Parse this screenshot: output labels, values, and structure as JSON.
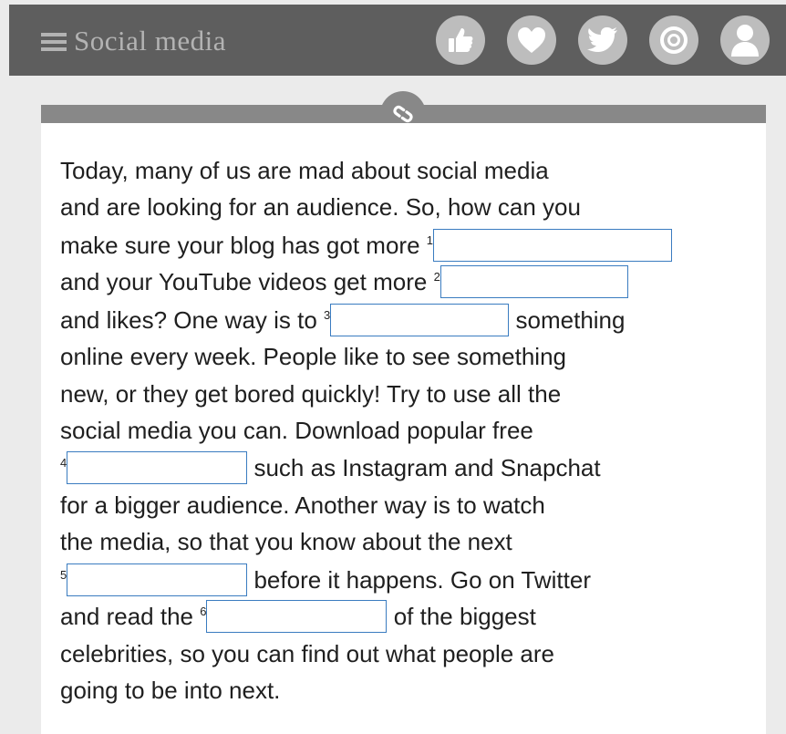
{
  "header": {
    "title": "Social media",
    "icons": [
      "thumbs-up-icon",
      "heart-icon",
      "twitter-bird-icon",
      "target-icon",
      "user-icon"
    ]
  },
  "link_icon": "link-icon",
  "text": {
    "line1": "Today, many of us are mad about social media",
    "line2": "and are looking for an audience. So, how can you",
    "line3": "make sure your blog has got more",
    "line4": "and your YouTube videos get more",
    "line5a": "and likes? One way is to",
    "line5b": "something",
    "line6": "online every week. People like to see something",
    "line7": "new, or they get bored quickly! Try to use all the",
    "line8": "social media you can. Download popular free",
    "line9": "such as Instagram and Snapchat",
    "line10": "for a bigger audience. Another way is to watch",
    "line11": "the media, so that you know about the next",
    "line12": "before it happens. Go on Twitter",
    "line13a": "and read the",
    "line13b": "of the biggest",
    "line14": "celebrities, so you can find out what people are",
    "line15": "going to be into next."
  },
  "blanks": [
    {
      "number": "1",
      "value": ""
    },
    {
      "number": "2",
      "value": ""
    },
    {
      "number": "3",
      "value": ""
    },
    {
      "number": "4",
      "value": ""
    },
    {
      "number": "5",
      "value": ""
    },
    {
      "number": "6",
      "value": ""
    }
  ]
}
